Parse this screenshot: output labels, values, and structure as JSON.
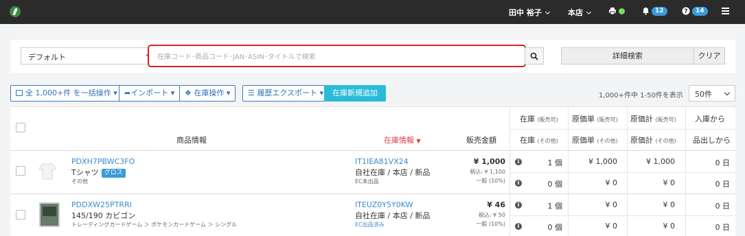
{
  "topbar": {
    "user_name": "田中 裕子",
    "store_name": "本店",
    "notifications_count": "12",
    "help_count": "14"
  },
  "search": {
    "preset_value": "デフォルト",
    "placeholder": "在庫コード･商品コード･JAN･ASIN･タイトルで検索",
    "advanced_label": "詳細検索",
    "clear_label": "クリア"
  },
  "toolbar": {
    "bulk_label": "全 1,000+件 を一括操作",
    "import_label": "インポート",
    "stock_ops_label": "在庫操作",
    "history_export_label": "履歴エクスポート",
    "add_stock_label": "在庫新規追加",
    "pager_text": "1,000+件中 1-50件を表示",
    "per_page_value": "50件"
  },
  "table": {
    "headers": {
      "product_info": "商品情報",
      "stock_info": "在庫情報",
      "sale_price": "販売金額",
      "stock": "在庫",
      "stock_sellable": "(販売可)",
      "stock_other": "(その他)",
      "unit_cost": "原価単",
      "total_cost": "原価計",
      "from_receipt": "入庫から",
      "since_out": "品出しから"
    },
    "rows": [
      {
        "sku": "PDXH7PBWC3FO",
        "name": "Tシャツ",
        "tag": "グロス",
        "category": "その他",
        "stock_code": "IT1IEA81VX24",
        "location": "自社在庫 / 本店 / 新品",
        "ec_status": "EC未出品",
        "price": "¥ 1,000",
        "price_tax": "税込: ¥ 1,100",
        "price_rank": "一般 (10%)",
        "sellable_qty": "1 個",
        "sellable_unit_cost": "¥ 1,000",
        "sellable_total_cost": "¥ 1,000",
        "days_from_receipt": "0 日",
        "other_qty": "0 個",
        "other_unit_cost": "¥ 0",
        "other_total_cost": "¥ 0",
        "days_since_out": "0 日"
      },
      {
        "sku": "PDDXW25PTRRI",
        "name": "145/190 カビゴン",
        "tag": "",
        "category": "トレーディングカードゲーム ＞ ポケモンカードゲーム ＞ シングル",
        "stock_code": "ITEUZ0Y5Y0KW",
        "location": "自社在庫 / 本店 / 新品",
        "ec_status": "EC出品済み",
        "price": "¥ 46",
        "price_tax": "税込: ¥ 50",
        "price_rank": "一般 (10%)",
        "sellable_qty": "1 個",
        "sellable_unit_cost": "¥ 0",
        "sellable_total_cost": "¥ 0",
        "days_from_receipt": "0 日",
        "other_qty": "0 個",
        "other_unit_cost": "¥ 0",
        "other_total_cost": "¥ 0",
        "days_since_out": "0 日"
      }
    ]
  },
  "colors": {
    "topbar": "#2b2b2b",
    "accent": "#3a9ad9",
    "primary_button": "#2bbbd8",
    "highlight_border": "#d6202a",
    "sort_header": "#e0393e"
  }
}
